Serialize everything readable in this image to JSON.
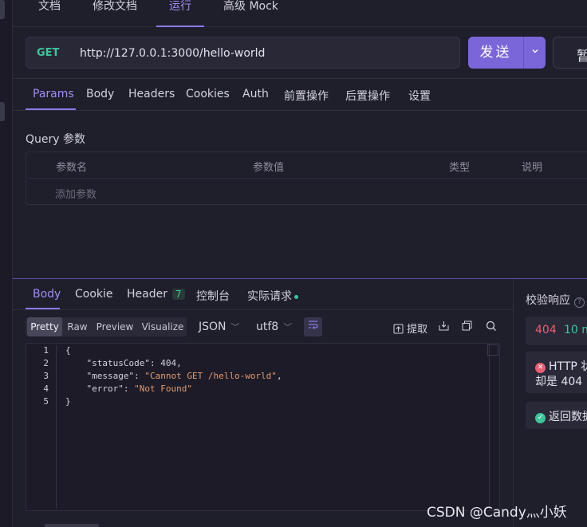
{
  "top_tabs": [
    "文档",
    "修改文档",
    "运行",
    "高级 Mock"
  ],
  "request": {
    "method": "GET",
    "url": "http://127.0.0.1:3000/hello-world",
    "send_label": "发送",
    "save_label": "暂"
  },
  "request_tabs": [
    "Params",
    "Body",
    "Headers",
    "Cookies",
    "Auth",
    "前置操作",
    "后置操作",
    "设置"
  ],
  "query": {
    "label": "Query 参数",
    "columns": [
      "参数名",
      "参数值",
      "类型",
      "说明"
    ],
    "add_placeholder": "添加参数"
  },
  "response_tabs": {
    "body": "Body",
    "cookie": "Cookie",
    "header": "Header",
    "header_count": "7",
    "console": "控制台",
    "actual_request": "实际请求"
  },
  "format_buttons": [
    "Pretty",
    "Raw",
    "Preview",
    "Visualize"
  ],
  "format_select": "JSON",
  "encoding_select": "utf8",
  "tools": {
    "extract": "提取"
  },
  "code_lines": [
    "{",
    "    \"statusCode\": 404,",
    "    \"message\": \"Cannot GET /hello-world\",",
    "    \"error\": \"Not Found\"",
    "}"
  ],
  "line_numbers": [
    "1",
    "2",
    "3",
    "4",
    "5"
  ],
  "json_body": {
    "keys": [
      "\"statusCode\"",
      "\"message\"",
      "\"error\""
    ],
    "values": [
      "404",
      "\"Cannot GET /hello-world\"",
      "\"Not Found\""
    ]
  },
  "verify": {
    "title": "校验响应",
    "status_code": "404",
    "time": "10 m",
    "http_check_line1": "HTTP 状",
    "http_check_line2": "却是 404",
    "schema_check": "返回数据"
  },
  "watermark": "CSDN @Candy灬小妖",
  "colors": {
    "accent": "#8b79e8",
    "success": "#3fc49a",
    "error": "#e95f72",
    "background": "#1f1e2b"
  }
}
